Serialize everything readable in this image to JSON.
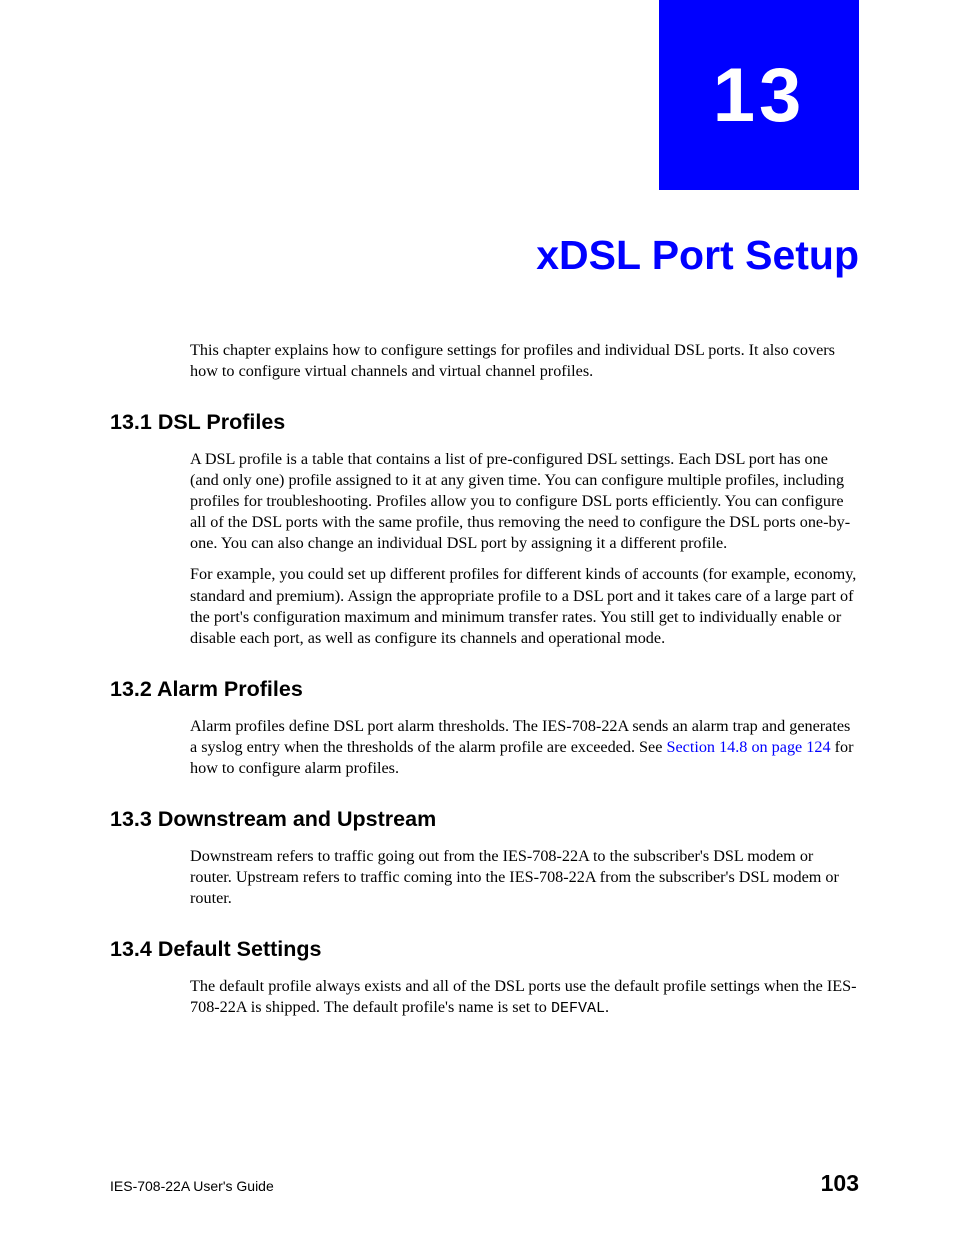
{
  "chapter": {
    "number": "13",
    "title": "xDSL Port Setup"
  },
  "intro": "This chapter explains how to configure settings for profiles and individual DSL ports. It also covers how to configure virtual channels and virtual channel profiles.",
  "sections": {
    "s1": {
      "heading": "13.1  DSL Profiles",
      "p1": "A DSL profile is a table that contains a list of pre-configured DSL settings. Each DSL port has one (and only one) profile assigned to it at any given time. You can configure multiple profiles, including profiles for troubleshooting. Profiles allow you to configure DSL ports efficiently. You can configure all of the DSL ports with the same profile, thus removing the need to configure the DSL ports one-by-one. You can also change an individual DSL port by assigning it a different profile.",
      "p2": "For example, you could set up different profiles for different kinds of accounts (for example, economy, standard and premium). Assign the appropriate profile to a DSL port and it takes care of a large part of the port's configuration maximum and minimum transfer rates. You still get to individually enable or disable each port, as well as configure its channels and operational mode."
    },
    "s2": {
      "heading": "13.2  Alarm Profiles",
      "p1_pre": "Alarm profiles define DSL port alarm thresholds. The IES-708-22A sends an alarm trap and generates a syslog entry when the thresholds of the alarm profile are exceeded. See ",
      "p1_link": "Section 14.8 on page 124",
      "p1_post": " for how to configure alarm profiles."
    },
    "s3": {
      "heading": "13.3  Downstream and Upstream",
      "p1": "Downstream refers to traffic going out from the IES-708-22A to the subscriber's DSL modem or router. Upstream refers to traffic coming into the IES-708-22A from the subscriber's DSL modem or router."
    },
    "s4": {
      "heading": "13.4  Default Settings",
      "p1_pre": "The default profile always exists and all of the DSL ports use the default profile settings when the IES-708-22A is shipped. The default profile's name is set to ",
      "p1_code": "DEFVAL",
      "p1_post": "."
    }
  },
  "footer": {
    "guide": "IES-708-22A User's Guide",
    "page": "103"
  }
}
